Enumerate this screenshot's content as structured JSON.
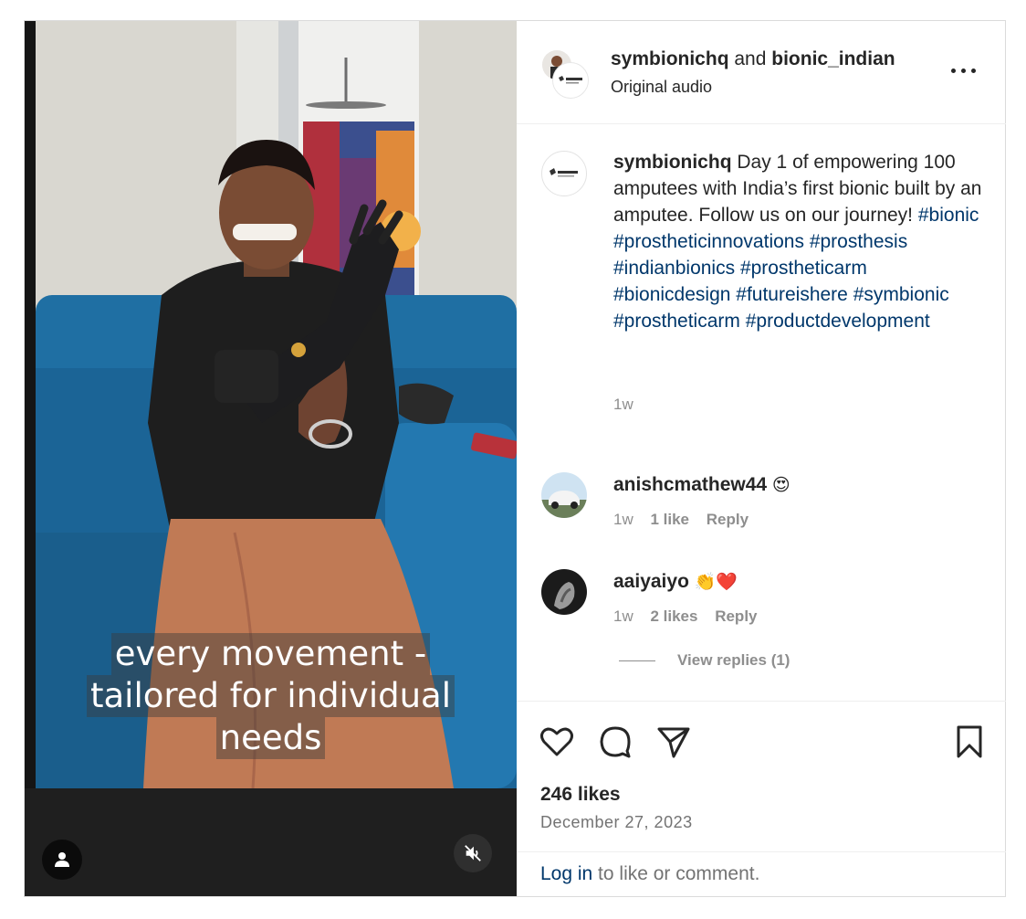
{
  "video": {
    "caption_lines": [
      "every movement -",
      "tailored for individual",
      "needs"
    ],
    "user_tag_icon": "person-icon",
    "mute_icon": "speaker-muted-icon"
  },
  "header": {
    "user1": "symbionichq",
    "and_text": " and ",
    "user2": "bionic_indian",
    "audio": "Original audio",
    "more_icon": "more-horizontal-icon"
  },
  "caption": {
    "username": "symbionichq",
    "text": "Day 1 of empowering 100 amputees with India’s first bionic built by an amputee. Follow us on our journey!",
    "hashtags": [
      "#bionic",
      "#prostheticinnovations",
      "#prosthesis",
      "#indianbionics",
      "#prostheticarm",
      "#bionicdesign",
      "#futureishere",
      "#symbionic",
      "#prostheticarm",
      "#productdevelopment"
    ],
    "time": "1w"
  },
  "comments": [
    {
      "username": "anishcmathew44",
      "emoji": "😍",
      "time": "1w",
      "likes": "1 like",
      "reply": "Reply"
    },
    {
      "username": "aaiyaiyo",
      "emoji": "👏❤️",
      "time": "1w",
      "likes": "2 likes",
      "reply": "Reply"
    }
  ],
  "view_replies": "View replies (1)",
  "actions": {
    "like_icon": "heart-icon",
    "comment_icon": "comment-icon",
    "share_icon": "send-icon",
    "save_icon": "bookmark-icon"
  },
  "likes": "246 likes",
  "date": "December 27, 2023",
  "login": {
    "link": "Log in",
    "rest": " to like or comment."
  },
  "colors": {
    "link": "#00376b",
    "muted": "#8e8e8e",
    "text": "#262626",
    "video_bg": "#1f1f1f"
  }
}
